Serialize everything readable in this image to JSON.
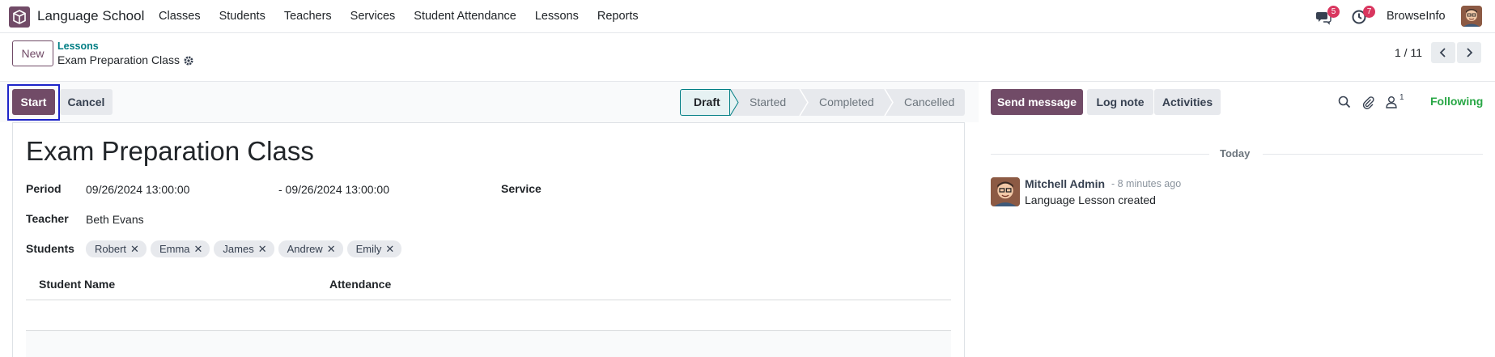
{
  "navbar": {
    "app_title": "Language School",
    "menu": [
      "Classes",
      "Students",
      "Teachers",
      "Services",
      "Student Attendance",
      "Lessons",
      "Reports"
    ],
    "messages_badge": "5",
    "activities_badge": "7",
    "company": "BrowseInfo"
  },
  "control": {
    "new_label": "New",
    "breadcrumb_parent": "Lessons",
    "breadcrumb_current": "Exam Preparation Class",
    "pager": "1 / 11"
  },
  "statusbar": {
    "start_label": "Start",
    "cancel_label": "Cancel",
    "stages": [
      "Draft",
      "Started",
      "Completed",
      "Cancelled"
    ],
    "active_stage": "Draft"
  },
  "form": {
    "title": "Exam Preparation Class",
    "period_label": "Period",
    "period_start": "09/26/2024 13:00:00",
    "period_end": "- 09/26/2024 13:00:00",
    "service_label": "Service",
    "teacher_label": "Teacher",
    "teacher_value": "Beth Evans",
    "students_label": "Students",
    "students": [
      "Robert",
      "Emma",
      "James",
      "Andrew",
      "Emily"
    ],
    "table_headers": [
      "Student Name",
      "Attendance"
    ]
  },
  "chatter": {
    "send_label": "Send message",
    "log_label": "Log note",
    "activities_label": "Activities",
    "followers_count": "1",
    "following_label": "Following",
    "date_separator": "Today",
    "message": {
      "author": "Mitchell Admin",
      "time": "- 8 minutes ago",
      "body": "Language Lesson created"
    }
  },
  "colors": {
    "brand": "#714b67",
    "teal": "#017e84",
    "following": "#28a745",
    "badge": "#d9365f"
  }
}
